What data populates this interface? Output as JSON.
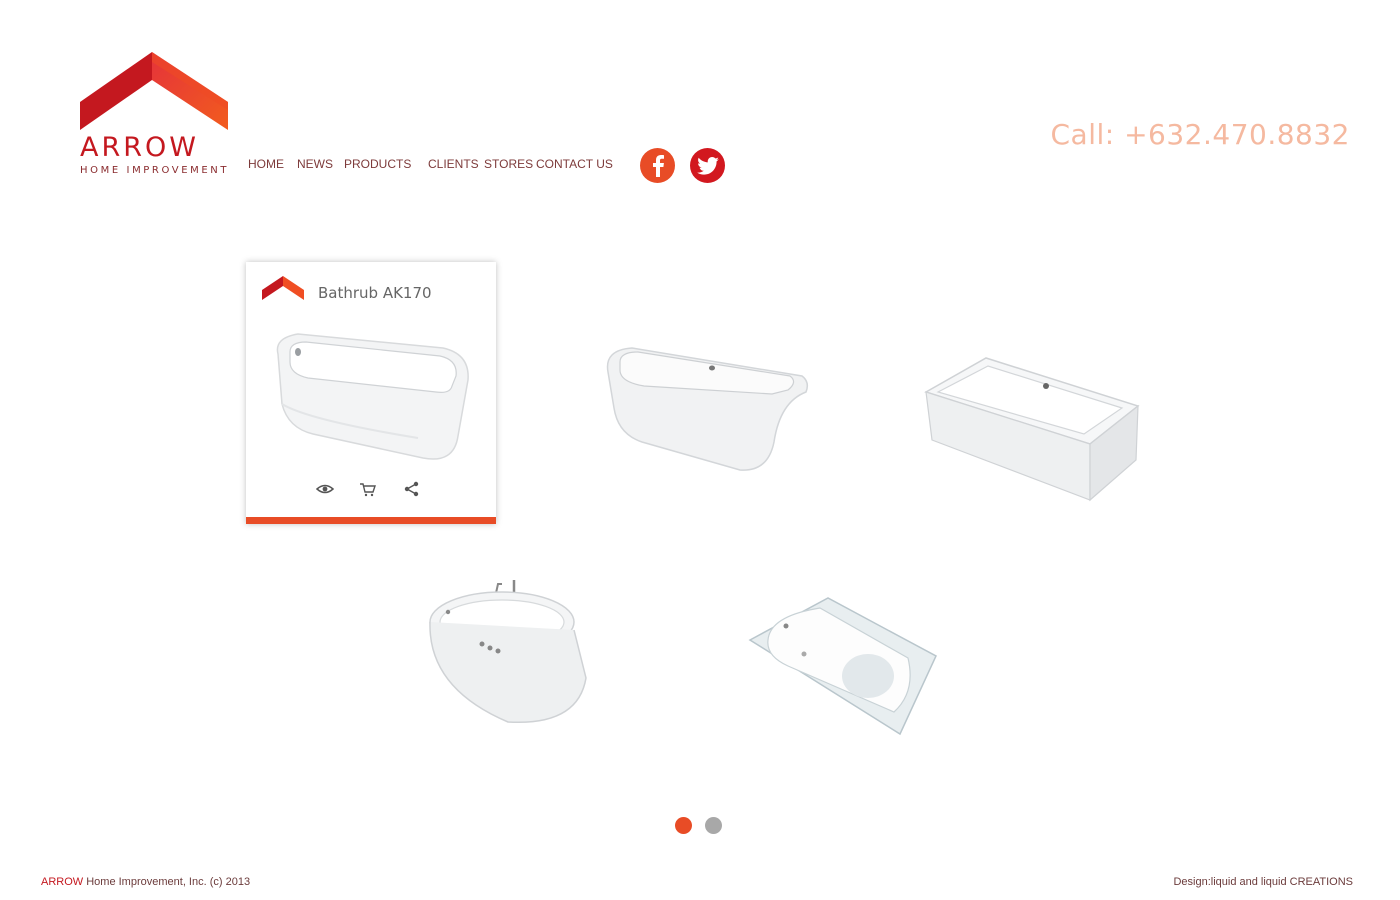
{
  "logo": {
    "word": "ARROW",
    "subtitle": "HOME IMPROVEMENT"
  },
  "nav": {
    "items": [
      {
        "label": "HOME"
      },
      {
        "label": "NEWS"
      },
      {
        "label": "PRODUCTS"
      },
      {
        "label": "CLIENTS"
      },
      {
        "label": "STORES"
      },
      {
        "label": "CONTACT US"
      }
    ]
  },
  "social": {
    "facebook_icon": "facebook-icon",
    "twitter_icon": "twitter-icon"
  },
  "contact": {
    "call": "Call: +632.470.8832"
  },
  "products": {
    "featured": {
      "title": "Bathrub AK170",
      "actions": [
        "eye-icon",
        "cart-icon",
        "share-icon"
      ]
    }
  },
  "pager": {
    "pages": 2,
    "active": 1
  },
  "footer": {
    "brand": "ARROW",
    "copyright": " Home Improvement, Inc. (c) 2013",
    "credit": "Design:liquid and liquid CREATIONS"
  },
  "colors": {
    "accent": "#e84c26",
    "brand_red": "#c4181f",
    "call_text": "#f5b9a0",
    "pager_inactive": "#a8a8a8"
  }
}
